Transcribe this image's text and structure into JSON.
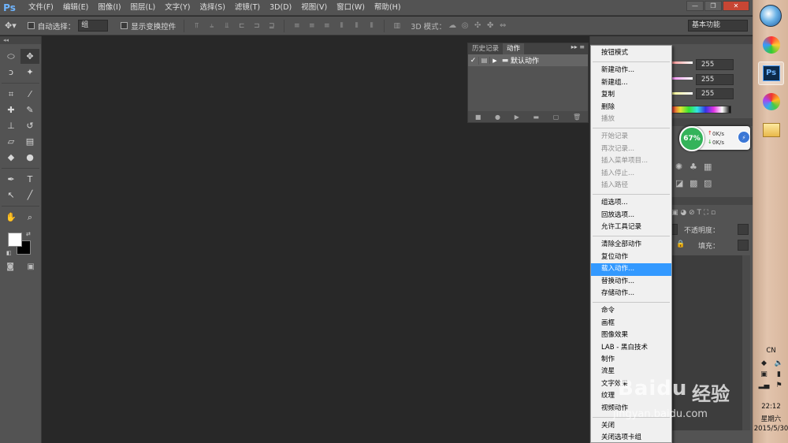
{
  "app": {
    "logo": "Ps",
    "menus": [
      "文件(F)",
      "编辑(E)",
      "图像(I)",
      "图层(L)",
      "文字(Y)",
      "选择(S)",
      "滤镜(T)",
      "3D(D)",
      "视图(V)",
      "窗口(W)",
      "帮助(H)"
    ],
    "window_controls": [
      "—",
      "❐",
      "✕"
    ]
  },
  "options_bar": {
    "auto_select_label": "自动选择：",
    "auto_select_value": "组",
    "show_transform_label": "显示变换控件",
    "mode_3d_label": "3D 模式：",
    "workspace": "基本功能"
  },
  "tools": [
    {
      "name": "marquee-tool",
      "glyph": "⬭"
    },
    {
      "name": "move-tool",
      "glyph": "✥",
      "active": true
    },
    {
      "name": "lasso-tool",
      "glyph": "ↄ"
    },
    {
      "name": "magic-wand-tool",
      "glyph": "✦"
    },
    {
      "name": "crop-tool",
      "glyph": "⌗"
    },
    {
      "name": "eyedropper-tool",
      "glyph": "⁄"
    },
    {
      "name": "healing-brush-tool",
      "glyph": "✚"
    },
    {
      "name": "brush-tool",
      "glyph": "✎"
    },
    {
      "name": "clone-stamp-tool",
      "glyph": "⊥"
    },
    {
      "name": "history-brush-tool",
      "glyph": "↺"
    },
    {
      "name": "eraser-tool",
      "glyph": "▱"
    },
    {
      "name": "gradient-tool",
      "glyph": "▤"
    },
    {
      "name": "blur-tool",
      "glyph": "◆"
    },
    {
      "name": "dodge-tool",
      "glyph": "●"
    },
    {
      "name": "pen-tool",
      "glyph": "✒"
    },
    {
      "name": "type-tool",
      "glyph": "T"
    },
    {
      "name": "path-selection-tool",
      "glyph": "↖"
    },
    {
      "name": "line-tool",
      "glyph": "╱"
    },
    {
      "name": "hand-tool",
      "glyph": "✋"
    },
    {
      "name": "zoom-tool",
      "glyph": "⌕"
    }
  ],
  "colors": {
    "foreground": "#ffffff",
    "background": "#000000"
  },
  "actions_panel": {
    "tabs": [
      "历史记录",
      "动作"
    ],
    "active_tab": "动作",
    "set_name": "默认动作",
    "checkmark": "✓"
  },
  "color_panel": {
    "values": [
      "255",
      "255",
      "255"
    ]
  },
  "layers_panel": {
    "opacity_label": "不透明度：",
    "fill_label": "填充："
  },
  "net_widget": {
    "percent": "67%",
    "upload": "0K/s",
    "download": "0K/s"
  },
  "flyout_menu": {
    "groups": [
      [
        {
          "label": "按钮模式"
        }
      ],
      [
        {
          "label": "新建动作..."
        },
        {
          "label": "新建组..."
        },
        {
          "label": "复制"
        },
        {
          "label": "删除"
        },
        {
          "label": "播放",
          "disabled": true
        }
      ],
      [
        {
          "label": "开始记录",
          "disabled": true
        },
        {
          "label": "再次记录...",
          "disabled": true
        },
        {
          "label": "插入菜单项目...",
          "disabled": true
        },
        {
          "label": "插入停止...",
          "disabled": true
        },
        {
          "label": "插入路径",
          "disabled": true
        }
      ],
      [
        {
          "label": "组选项..."
        },
        {
          "label": "回放选项..."
        },
        {
          "label": "允许工具记录"
        }
      ],
      [
        {
          "label": "清除全部动作"
        },
        {
          "label": "复位动作"
        },
        {
          "label": "载入动作...",
          "highlight": true
        },
        {
          "label": "替换动作..."
        },
        {
          "label": "存储动作..."
        }
      ],
      [
        {
          "label": "命令"
        },
        {
          "label": "画框"
        },
        {
          "label": "图像效果"
        },
        {
          "label": "LAB - 黑白技术"
        },
        {
          "label": "制作"
        },
        {
          "label": "流星"
        },
        {
          "label": "文字效果"
        },
        {
          "label": "纹理"
        },
        {
          "label": "视频动作"
        }
      ],
      [
        {
          "label": "关闭"
        },
        {
          "label": "关闭选项卡组"
        }
      ]
    ]
  },
  "taskbar": {
    "ps_label": "Ps",
    "lang": "CN",
    "time": "22:12",
    "weekday": "星期六",
    "date": "2015/5/30"
  },
  "watermark": {
    "logo": "Baidu",
    "text": "经验",
    "url": "jingyan.baidu.com"
  }
}
